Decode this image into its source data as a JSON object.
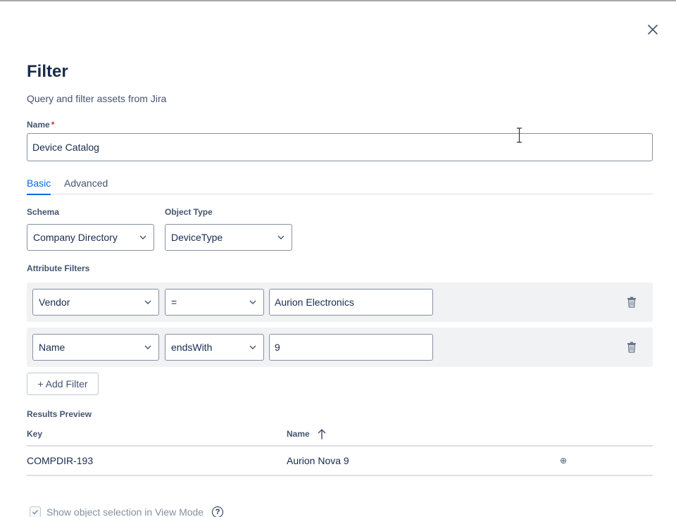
{
  "dialog": {
    "title": "Filter",
    "subtitle": "Query and filter assets from Jira"
  },
  "name_field": {
    "label": "Name",
    "required_marker": "*",
    "value": "Device Catalog"
  },
  "tabs": [
    {
      "label": "Basic",
      "active": true
    },
    {
      "label": "Advanced",
      "active": false
    }
  ],
  "schema": {
    "label": "Schema",
    "value": "Company Directory"
  },
  "object_type": {
    "label": "Object Type",
    "value": "DeviceType"
  },
  "attribute_filters": {
    "label": "Attribute Filters",
    "rows": [
      {
        "attribute": "Vendor",
        "operator": "=",
        "value": "Aurion Electronics"
      },
      {
        "attribute": "Name",
        "operator": "endsWith",
        "value": "9"
      }
    ],
    "add_button_label": "+ Add Filter"
  },
  "results": {
    "label": "Results Preview",
    "columns": [
      "Key",
      "Name"
    ],
    "sort_column": "Name",
    "sort_direction": "ascending",
    "rows": [
      {
        "key": "COMPDIR-193",
        "name": "Aurion Nova 9",
        "action_icon": "⊕"
      }
    ]
  },
  "view_mode": {
    "label": "Show object selection in View Mode",
    "checked": true,
    "disabled": true,
    "help_glyph": "?"
  },
  "icons": {
    "close": "close-icon",
    "chevron": "chevron-down-icon",
    "trash": "trash-icon",
    "sort": "arrow-up-icon"
  },
  "colors": {
    "accent": "#0c66e4",
    "text": "#172b4d",
    "subtle_text": "#44546f",
    "required": "#c9372c",
    "filter_row_bg": "#f1f2f4"
  }
}
